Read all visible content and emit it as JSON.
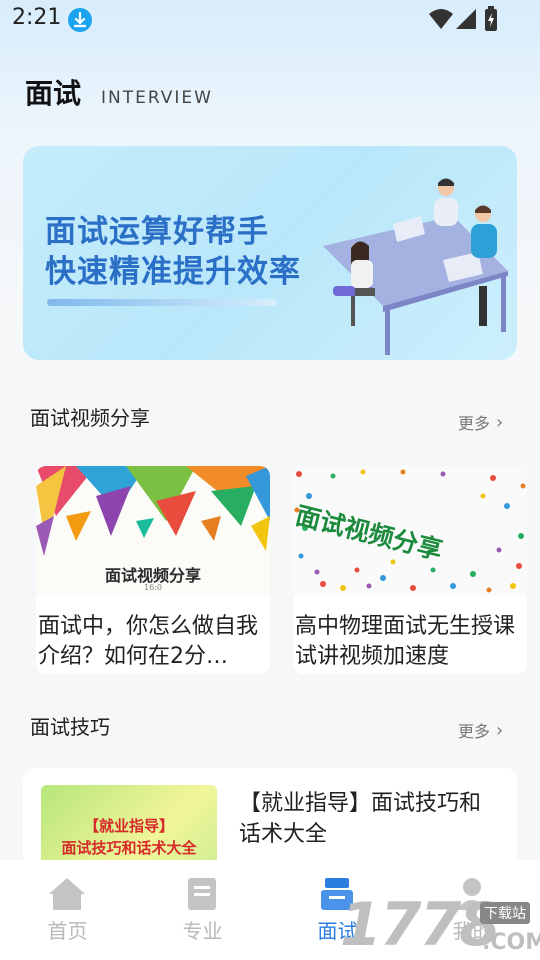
{
  "status_bar": {
    "time": "2:21",
    "icons": [
      "download-icon",
      "wifi-icon",
      "signal-icon",
      "battery-icon"
    ]
  },
  "header": {
    "title": "面试",
    "subtitle": "INTERVIEW"
  },
  "banner": {
    "line1": "面试运算好帮手",
    "line2": "快速精准提升效率",
    "accent_color": "#2b6fc7"
  },
  "video_section": {
    "title": "面试视频分享",
    "more_label": "更多",
    "cards": [
      {
        "thumb_caption": "面试视频分享",
        "thumb_version": "16:0",
        "title": "面试中，你怎么做自我介绍？如何在2分…"
      },
      {
        "thumb_caption": "面试视频分享",
        "title": "高中物理面试无生授课试讲视频加速度"
      }
    ]
  },
  "tips_section": {
    "title": "面试技巧",
    "more_label": "更多",
    "items": [
      {
        "thumb_line1": "【就业指导】",
        "thumb_line2": "面试技巧和话术大全",
        "title": "【就业指导】面试技巧和话术大全"
      }
    ]
  },
  "bottom_nav": {
    "items": [
      {
        "label": "首页",
        "icon": "home-icon",
        "active": false
      },
      {
        "label": "专业",
        "icon": "document-icon",
        "active": false
      },
      {
        "label": "面试",
        "icon": "interview-icon",
        "active": true
      },
      {
        "label": "我的",
        "icon": "profile-icon",
        "active": false
      }
    ],
    "active_color": "#2b7de0",
    "inactive_color": "#b9b9b9"
  },
  "watermark": {
    "number": "1778",
    "download_label": "下载站",
    "domain": ".COM"
  }
}
